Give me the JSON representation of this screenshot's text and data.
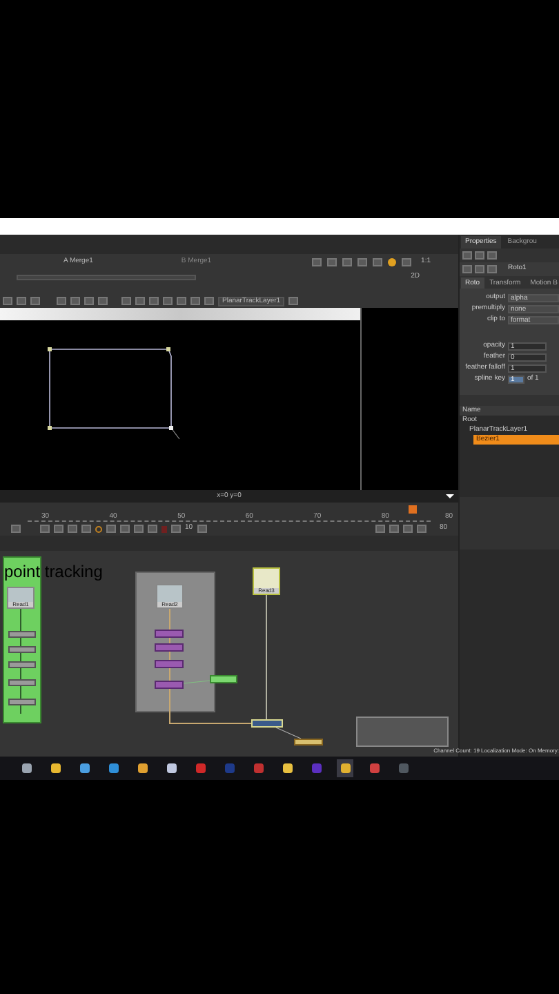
{
  "viewer": {
    "input_a": "A Merge1",
    "input_b": "B Merge1",
    "zoom": "1:1",
    "view_mode": "2D",
    "layer": "PlanarTrackLayer1",
    "coordinates": "x=0 y=0"
  },
  "timeline": {
    "ticks": [
      "30",
      "40",
      "50",
      "60",
      "70",
      "80"
    ],
    "step": "10",
    "in_frame": "80",
    "out_frame": "80"
  },
  "node_graph": {
    "backdrop_label": "point tracking",
    "nodes": [
      {
        "kind": "read",
        "label": "Read1"
      },
      {
        "kind": "read",
        "label": "Read2"
      },
      {
        "kind": "read",
        "label": "Read3"
      },
      {
        "kind": "roto"
      },
      {
        "kind": "merge"
      },
      {
        "kind": "viewer"
      }
    ]
  },
  "properties": {
    "tabs": [
      {
        "label": "Properties",
        "selected": true
      },
      {
        "label": "Backgrou",
        "selected": false
      }
    ],
    "node_name": "Roto1",
    "node_tabs": [
      {
        "label": "Roto",
        "selected": true
      },
      {
        "label": "Transform",
        "selected": false
      },
      {
        "label": "Motion B",
        "selected": false
      }
    ],
    "knobs": [
      {
        "label": "output",
        "value": "alpha",
        "kind": "menu"
      },
      {
        "label": "premultiply",
        "value": "none",
        "kind": "menu"
      },
      {
        "label": "clip to",
        "value": "format",
        "kind": "menu"
      },
      {
        "label": "opacity",
        "value": "1",
        "kind": "number"
      },
      {
        "label": "feather",
        "value": "0",
        "kind": "number"
      },
      {
        "label": "feather falloff",
        "value": "1",
        "kind": "number"
      },
      {
        "label": "spline key",
        "value": "1",
        "suffix": "of 1",
        "kind": "key"
      }
    ],
    "tree_header": "Name",
    "tree": [
      {
        "label": "Root",
        "selected": false,
        "children": [
          {
            "label": "PlanarTrackLayer1",
            "selected": false,
            "children": [
              {
                "label": "Bezier1",
                "selected": true
              }
            ]
          }
        ]
      }
    ]
  },
  "status_bar": "Channel Count: 19 Localization Mode: On Memory:",
  "taskbar": [
    {
      "color": "#9aa4b0",
      "selected": false
    },
    {
      "color": "#e8b830",
      "selected": false
    },
    {
      "color": "#4a9ee0",
      "selected": false
    },
    {
      "color": "#2f8fd8",
      "selected": false
    },
    {
      "color": "#e0a030",
      "selected": false
    },
    {
      "color": "#c0c8e0",
      "selected": false
    },
    {
      "color": "#d02828",
      "selected": false
    },
    {
      "color": "#1e3a8a",
      "selected": false
    },
    {
      "color": "#c03030",
      "selected": false
    },
    {
      "color": "#e8c040",
      "selected": false
    },
    {
      "color": "#5b2fc0",
      "selected": false
    },
    {
      "color": "#e0b030",
      "selected": true
    },
    {
      "color": "#d04040",
      "selected": false
    },
    {
      "color": "#505860",
      "selected": false
    }
  ]
}
